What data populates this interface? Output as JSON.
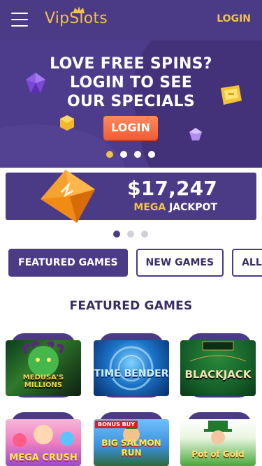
{
  "header": {
    "logo_text": "VipSlots",
    "login_label": "LOGIN"
  },
  "hero": {
    "title_lines": [
      "LOVE FREE SPINS?",
      "LOGIN TO SEE",
      "OUR SPECIALS"
    ],
    "button_label": "LOGIN",
    "active_slide": 1,
    "slide_count": 4
  },
  "jackpot": {
    "amount": "$17,247",
    "label_accent": "MEGA",
    "label_rest": "JACKPOT",
    "active_slide": 1,
    "slide_count": 3
  },
  "tabs": [
    {
      "label": "FEATURED GAMES",
      "active": true
    },
    {
      "label": "NEW GAMES",
      "active": false
    },
    {
      "label": "ALL SLOTS",
      "active": false
    }
  ],
  "section_title": "FEATURED GAMES",
  "games": [
    {
      "title": "MEDUSA'S MILLIONS",
      "icon": "medusa-thumbnail"
    },
    {
      "title": "TIME BENDER",
      "icon": "time-bender-thumbnail"
    },
    {
      "title": "BLACKJACK",
      "icon": "blackjack-thumbnail"
    },
    {
      "title": "MEGA CRUSH",
      "icon": "mega-crush-thumbnail"
    },
    {
      "title": "BIG SALMON RUN",
      "badge": "BONUS BUY",
      "icon": "salmon-thumbnail"
    },
    {
      "title": "Pot of Gold",
      "icon": "pot-of-gold-thumbnail"
    }
  ],
  "colors": {
    "primary": "#4b3a86",
    "accent": "#f2c14e",
    "cta": "#ef5d35"
  }
}
